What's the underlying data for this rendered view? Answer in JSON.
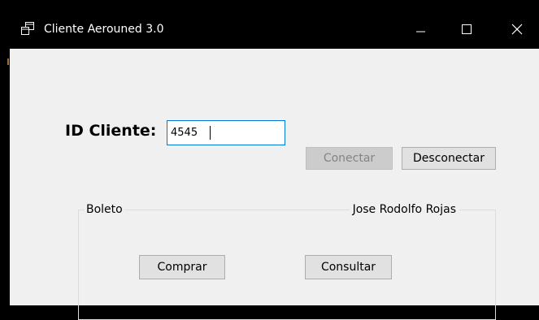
{
  "window": {
    "title": "Cliente Aerouned 3.0",
    "icon": "app-window-icon",
    "controls": {
      "minimize": "minimize-icon",
      "maximize": "maximize-icon",
      "close": "close-icon"
    }
  },
  "form": {
    "id_label": "ID Cliente:",
    "id_value": "4545",
    "conectar_label": "Conectar",
    "conectar_enabled": false,
    "desconectar_label": "Desconectar"
  },
  "group": {
    "title": "Boleto",
    "client_name": "Jose Rodolfo Rojas",
    "comprar_label": "Comprar",
    "consultar_label": "Consultar"
  },
  "colors": {
    "titlebar": "#000000",
    "client_area": "#f0f0f0",
    "input_focus_border": "#0078d7",
    "button_face": "#e1e1e1",
    "button_disabled_text": "#838383"
  }
}
